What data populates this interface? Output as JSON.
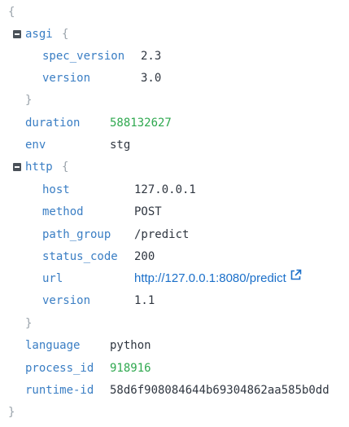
{
  "brace_open": "{",
  "brace_close": "}",
  "asgi": {
    "key": "asgi",
    "brace_open": "{",
    "brace_close": "}",
    "spec_version": {
      "key": "spec_version",
      "value": "2.3"
    },
    "version": {
      "key": "version",
      "value": "3.0"
    }
  },
  "duration": {
    "key": "duration",
    "value": "588132627"
  },
  "env": {
    "key": "env",
    "value": "stg"
  },
  "http": {
    "key": "http",
    "brace_open": "{",
    "brace_close": "}",
    "host": {
      "key": "host",
      "value": "127.0.0.1"
    },
    "method": {
      "key": "method",
      "value": "POST"
    },
    "path_group": {
      "key": "path_group",
      "value": "/predict"
    },
    "status_code": {
      "key": "status_code",
      "value": "200"
    },
    "url": {
      "key": "url",
      "value": "http://127.0.0.1:8080/predict",
      "icon": "external-link-icon"
    },
    "version": {
      "key": "version",
      "value": "1.1"
    }
  },
  "language": {
    "key": "language",
    "value": "python"
  },
  "process_id": {
    "key": "process_id",
    "value": "918916"
  },
  "runtime_id": {
    "key": "runtime-id",
    "value": "58d6f908084644b69304862aa585b0dd"
  },
  "colors": {
    "key": "#3a7ec4",
    "number": "#2fa84f",
    "link": "#1a6fc9",
    "brace": "#9aa3ab"
  }
}
